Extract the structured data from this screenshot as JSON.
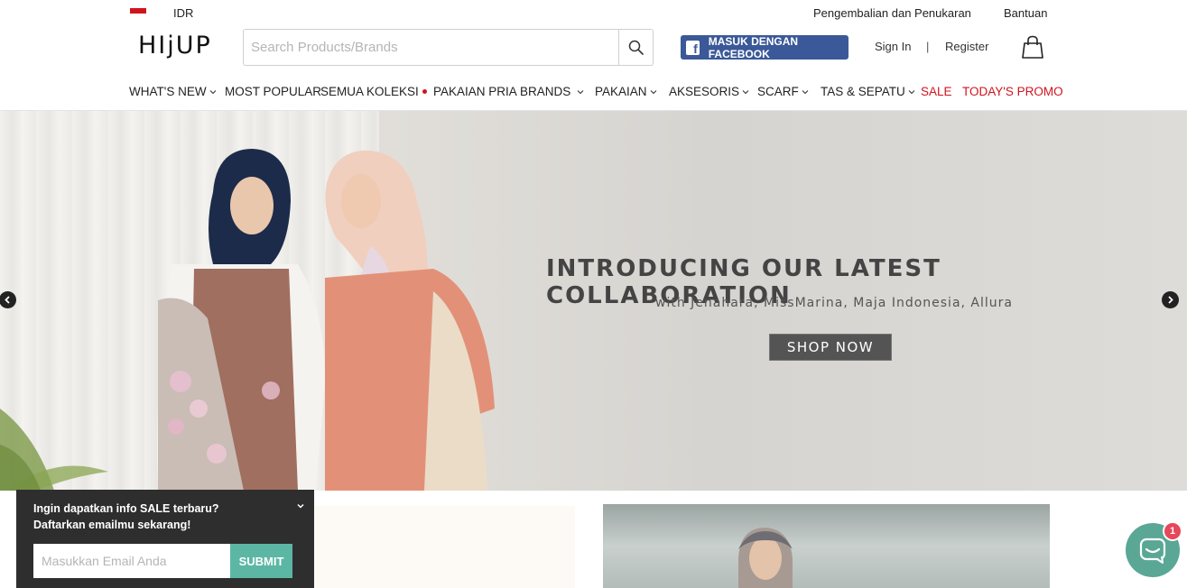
{
  "topbar": {
    "currency": "IDR",
    "links": [
      "Pengembalian dan Penukaran",
      "Bantuan"
    ]
  },
  "header": {
    "logo": "HIjUP",
    "search_placeholder": "Search Products/Brands",
    "facebook_label": "MASUK DENGAN FACEBOOK",
    "facebook_icon": "f",
    "sign_in": "Sign In",
    "separator": "|",
    "register": "Register"
  },
  "nav": {
    "items": [
      {
        "label": "WHAT'S NEW"
      },
      {
        "label": "MOST POPULAR"
      },
      {
        "label": "SEMUA KOLEKSI"
      },
      {
        "label": "PAKAIAN PRIA"
      },
      {
        "label": "BRANDS"
      },
      {
        "label": "PAKAIAN"
      },
      {
        "label": "AKSESORIS"
      },
      {
        "label": "SCARF"
      },
      {
        "label": "TAS & SEPATU"
      },
      {
        "label": "SALE"
      },
      {
        "label": "TODAY'S PROMO"
      }
    ]
  },
  "hero": {
    "title": "INTRODUCING OUR LATEST COLLABORATION",
    "subtitle": "with Jenahara, MissMarina, Maja Indonesia, Allura",
    "cta": "SHOP NOW"
  },
  "newsletter": {
    "line1": "Ingin dapatkan info SALE terbaru?",
    "line2": "Daftarkan emailmu sekarang!",
    "placeholder": "Masukkan Email Anda",
    "submit": "SUBMIT"
  },
  "chat": {
    "badge": "1"
  },
  "colors": {
    "accent_red": "#d0141e",
    "facebook_blue": "#3b5998",
    "submit_teal": "#5bb7a4",
    "chat_teal": "#5aa796",
    "badge_red": "#e5475b"
  }
}
